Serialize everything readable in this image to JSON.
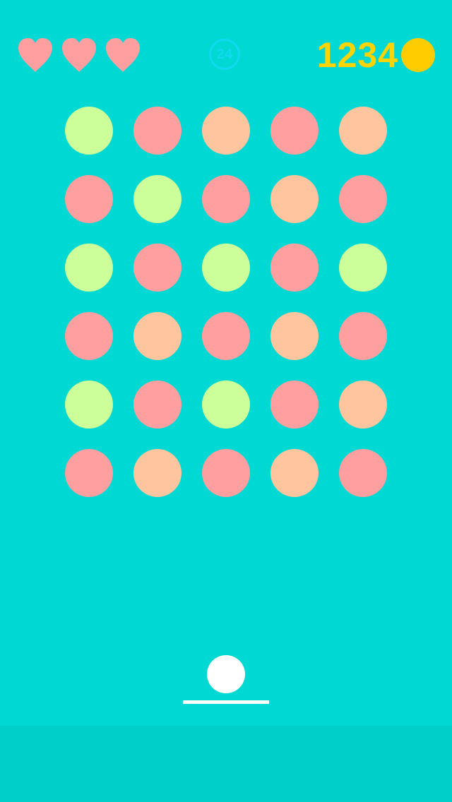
{
  "colors": {
    "background": "#00D8D4",
    "bottom_bar": "#00CEC9",
    "heart": "#FF9FA0",
    "level_badge": "#10D9F0",
    "coin_text": "#FFD400",
    "coin_icon": "#FFCC00",
    "ball": "#FFFFFF",
    "paddle": "#FFFFFF"
  },
  "hud": {
    "lives": 3,
    "hearts": [
      {
        "icon": "heart-icon"
      },
      {
        "icon": "heart-icon"
      },
      {
        "icon": "heart-icon"
      }
    ],
    "level": "24",
    "coins": "1234",
    "coin_icon": "coin-icon"
  },
  "grid": {
    "rows": [
      [
        "#CCFF99",
        "#FF9FA0",
        "#FFC59E",
        "#FF9FA0",
        "#FFC59E"
      ],
      [
        "#FF9FA0",
        "#CCFF99",
        "#FF9FA0",
        "#FFC59E",
        "#FF9FA0"
      ],
      [
        "#CCFF99",
        "#FF9FA0",
        "#CCFF99",
        "#FF9FA0",
        "#CCFF99"
      ],
      [
        "#FF9FA0",
        "#FFC59E",
        "#FF9FA0",
        "#FFC59E",
        "#FF9FA0"
      ],
      [
        "#CCFF99",
        "#FF9FA0",
        "#CCFF99",
        "#FF9FA0",
        "#FFC59E"
      ],
      [
        "#FF9FA0",
        "#FFC59E",
        "#FF9FA0",
        "#FFC59E",
        "#FF9FA0"
      ]
    ]
  },
  "launcher": {
    "ball_icon": "ball",
    "paddle_icon": "paddle"
  }
}
